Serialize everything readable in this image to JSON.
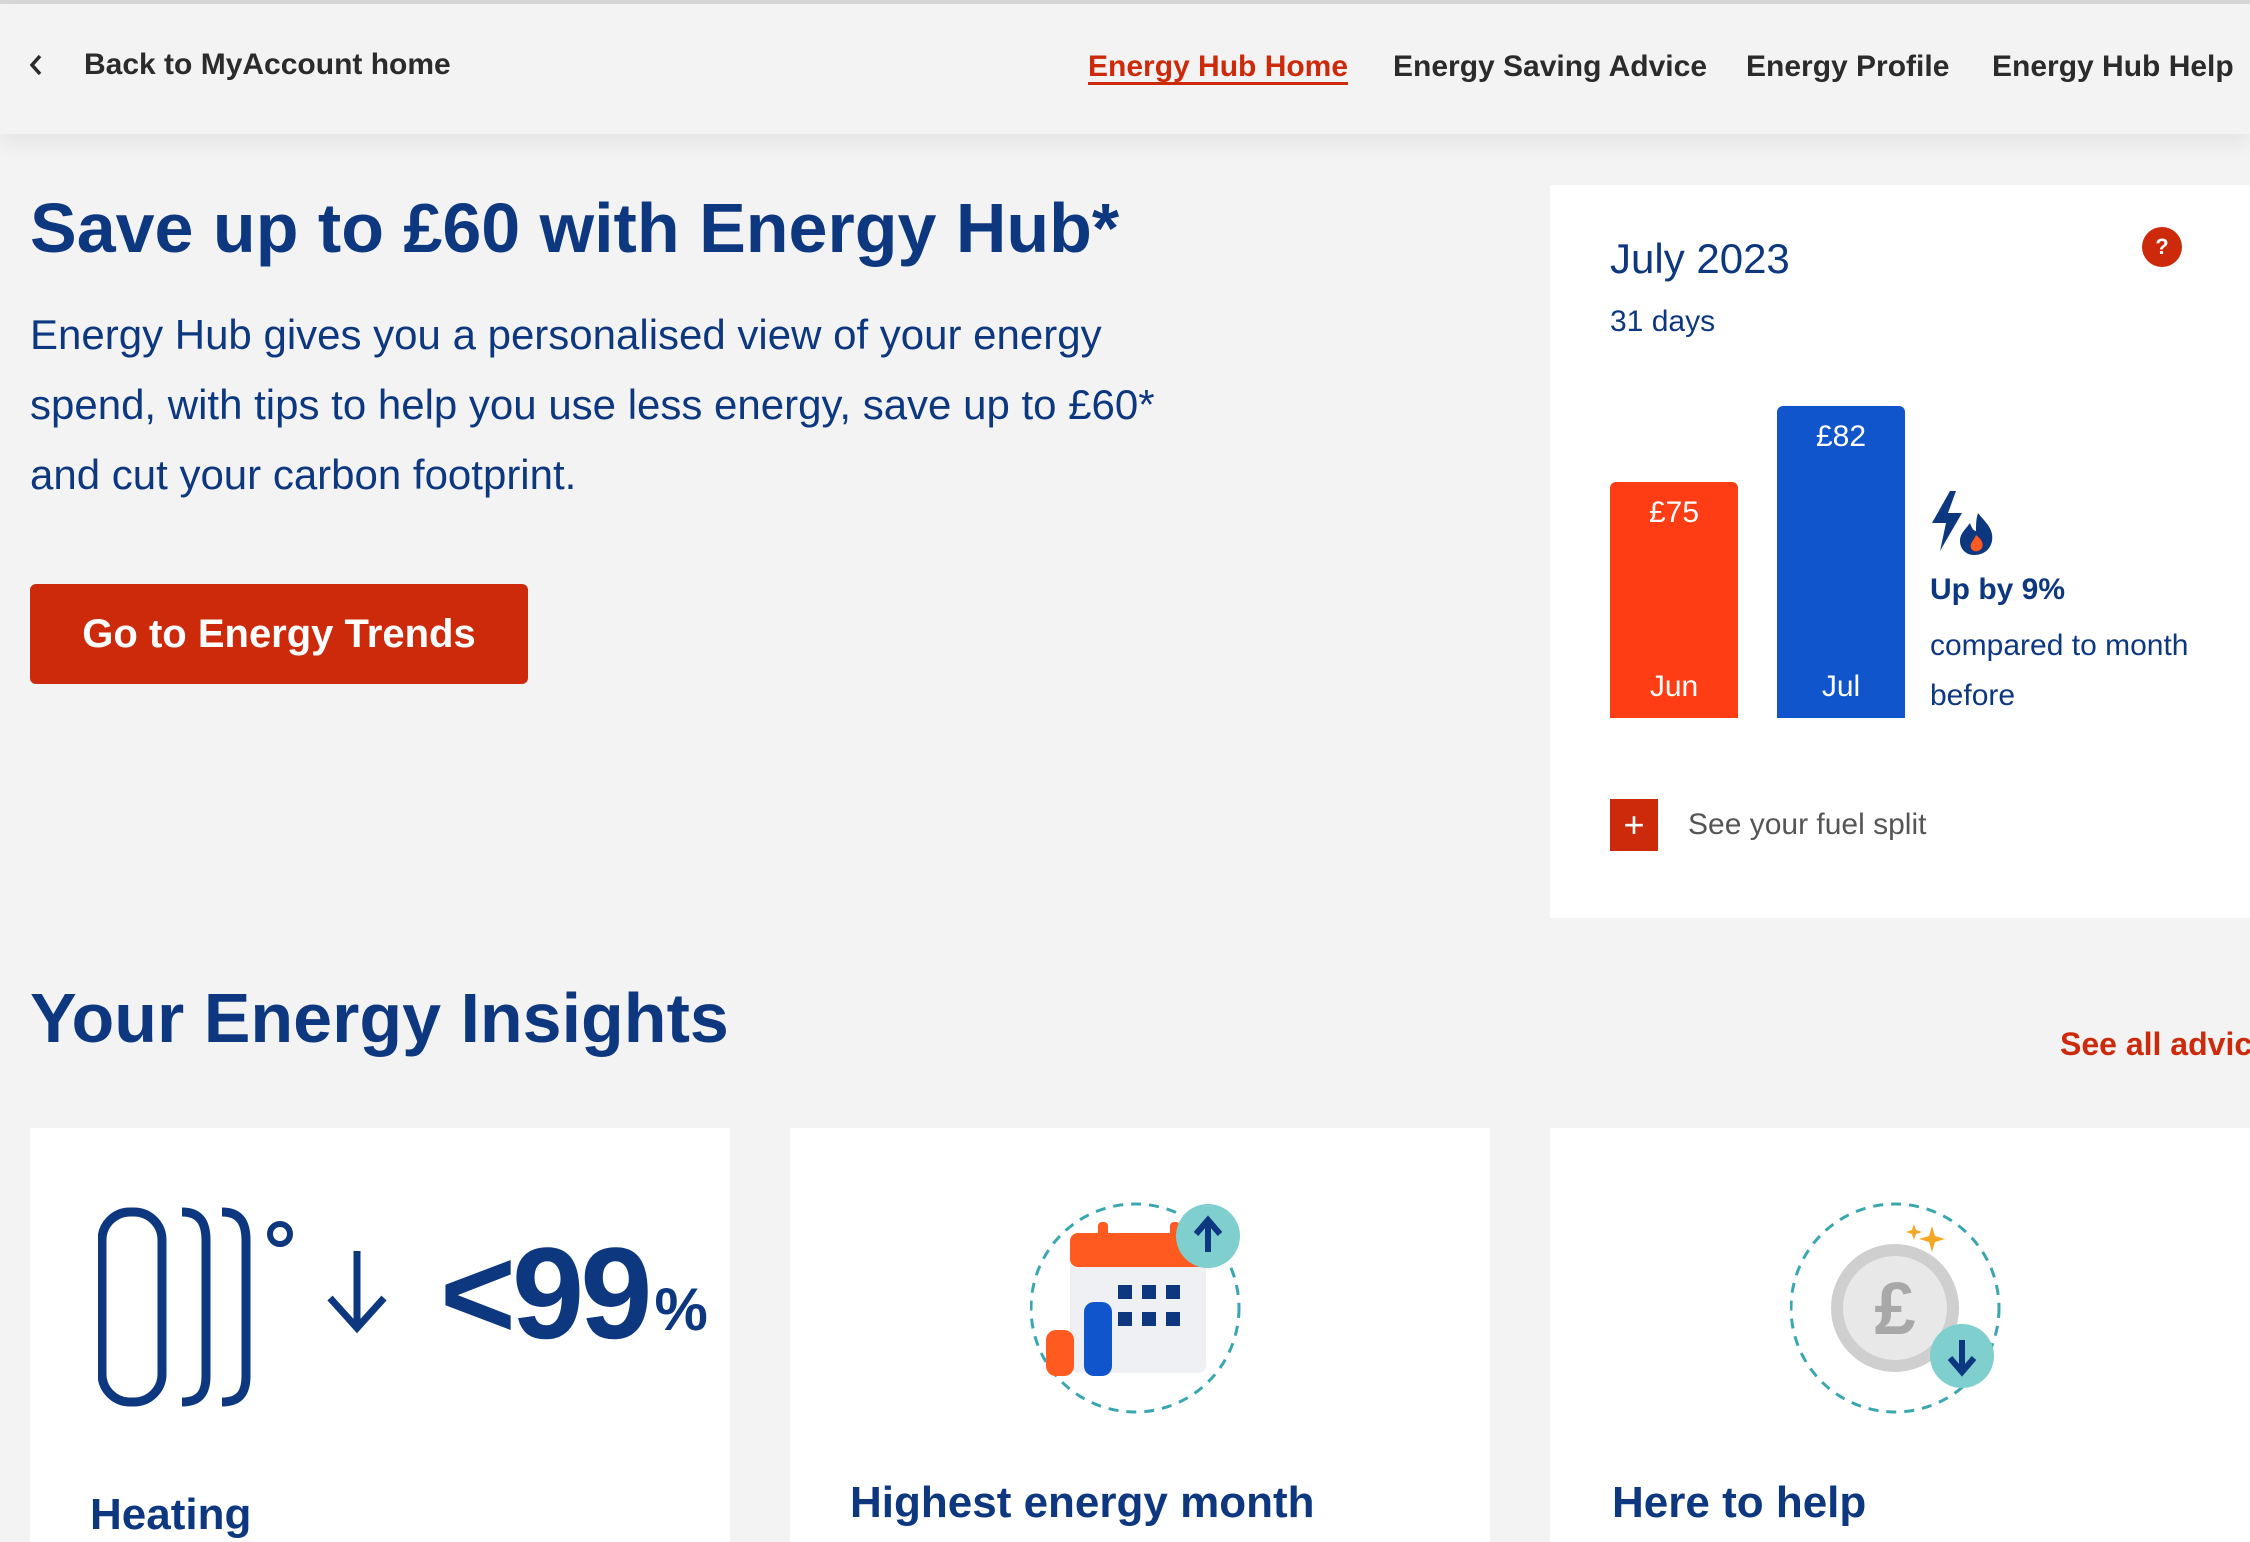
{
  "nav": {
    "back_label": "Back to MyAccount home",
    "links": [
      "Energy Hub Home",
      "Energy Saving Advice",
      "Energy Profile",
      "Energy Hub Help"
    ],
    "active_index": 0
  },
  "hero": {
    "title": "Save up to £60 with Energy Hub*",
    "line1": "Energy Hub gives you a personalised view of your energy",
    "line2": "spend, with tips to help you use less energy, save up to £60*",
    "line3": "and cut your carbon footprint.",
    "cta_label": "Go to Energy Trends"
  },
  "summary_card": {
    "month": "July 2023",
    "days": "31 days",
    "help_symbol": "?",
    "trend_headline": "Up by 9%",
    "trend_sub": "compared to month before",
    "fuel_split_label": "See your fuel split",
    "plus_symbol": "+"
  },
  "chart_data": {
    "type": "bar",
    "categories": [
      "Jun",
      "Jul"
    ],
    "values": [
      75,
      82
    ],
    "value_labels": [
      "£75",
      "£82"
    ],
    "colors": [
      "#ff3d14",
      "#1055cc"
    ]
  },
  "insights": {
    "title": "Your Energy Insights",
    "see_all_label": "See all advice",
    "tiles": [
      {
        "title": "Heating",
        "stat": "<99",
        "stat_unit": "%"
      },
      {
        "title": "Highest energy month"
      },
      {
        "title": "Here to help"
      }
    ]
  },
  "colors": {
    "brand_blue": "#0d3880",
    "brand_red": "#cc2a0a",
    "orange": "#ff5a1f",
    "teal": "#7fcfcf"
  }
}
